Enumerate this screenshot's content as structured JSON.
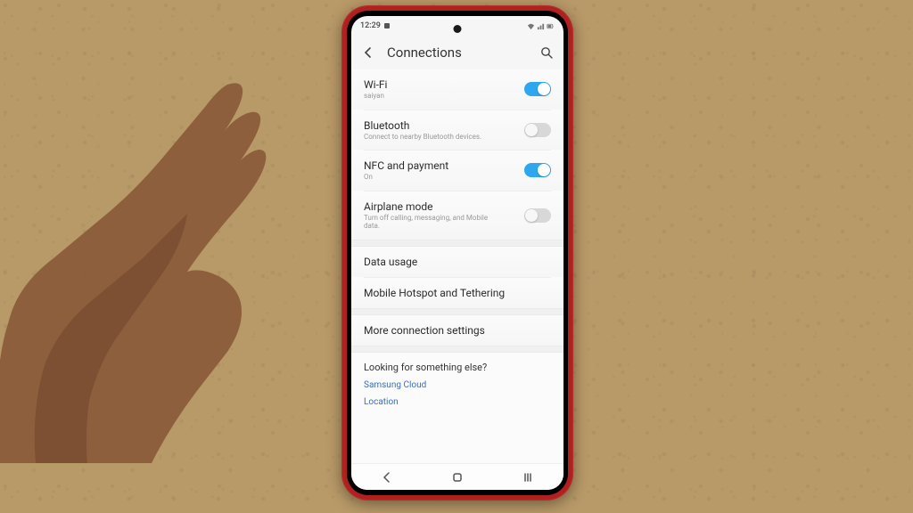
{
  "status": {
    "time": "12:29",
    "icons": [
      "signal",
      "wifi",
      "battery"
    ]
  },
  "header": {
    "title": "Connections"
  },
  "items": [
    {
      "title": "Wi-Fi",
      "sub": "saiyan",
      "toggle": "on"
    },
    {
      "title": "Bluetooth",
      "sub": "Connect to nearby Bluetooth devices.",
      "toggle": "off"
    },
    {
      "title": "NFC and payment",
      "sub": "On",
      "toggle": "on"
    },
    {
      "title": "Airplane mode",
      "sub": "Turn off calling, messaging, and Mobile data.",
      "toggle": "off"
    },
    {
      "title": "Data usage"
    },
    {
      "title": "Mobile Hotspot and Tethering"
    },
    {
      "title": "More connection settings"
    }
  ],
  "footer": {
    "title": "Looking for something else?",
    "links": [
      "Samsung Cloud",
      "Location"
    ]
  }
}
